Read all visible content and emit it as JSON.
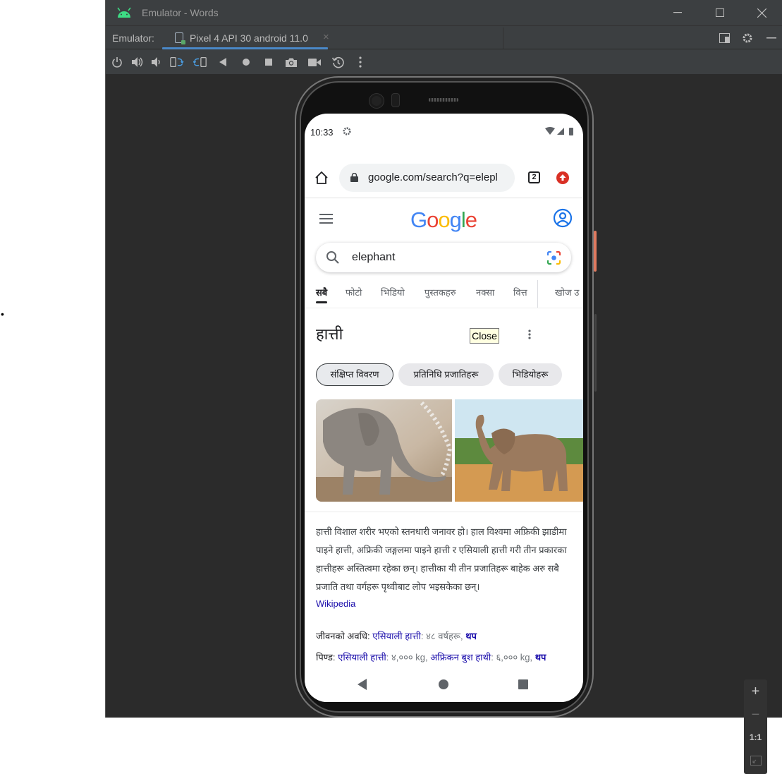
{
  "window": {
    "title": "Emulator - Words"
  },
  "tabbar": {
    "label": "Emulator:",
    "tab_name": "Pixel 4 API 30 android 11.0",
    "close_glyph": "×"
  },
  "zoom": {
    "plus": "+",
    "minus": "−",
    "one_to_one": "1:1"
  },
  "phone": {
    "status": {
      "time": "10:33"
    },
    "browser": {
      "url": "google.com/search?q=elepl",
      "tab_count": "2"
    },
    "search": {
      "query": "elephant"
    },
    "tabs": [
      "सबै",
      "फोटो",
      "भिडियो",
      "पुस्तकहरु",
      "नक्सा",
      "वित्त",
      "खोज उ"
    ],
    "knowledge": {
      "title": "हात्ती",
      "tooltip": "Close",
      "chips": [
        "संक्षिप्त विवरण",
        "प्रतिनिधि प्रजातिहरू",
        "भिडियोहरू"
      ],
      "description": "हात्ती विशाल शरीर भएको स्तनधारी जनावर हो। हाल विश्वमा अफ्रिकी झाडीमा पाइने हात्ती, अफ्रिकी जङ्गलमा पाइने हात्ती र एसियाली हात्ती गरी तीन प्रकारका हात्तीहरू अस्तित्वमा रहेका छन्। हात्तीका यी तीन प्रजातिहरू बाहेक अरु सबै प्रजाति तथा वर्गहरू पृथ्वीबाट लोप भइसकेका छन्।",
      "source": "Wikipedia",
      "lifespan": {
        "label": "जीवनको अवधि:",
        "link": "एसियाली हात्ती",
        "value": ": ४८ वर्षहरू,",
        "more": "थप"
      },
      "mass": {
        "label": "पिण्ड:",
        "link1": "एसियाली हात्ती",
        "value1": ": ४,००० kg,",
        "link2": "अफ्रिकन बुश हाथी",
        "value2": ": ६,००० kg,",
        "more": "थप"
      }
    }
  },
  "colors": {
    "ide_bg": "#2b2b2b",
    "ide_bar": "#3c3f41",
    "accent": "#4a88c7",
    "link": "#1a0dab"
  }
}
